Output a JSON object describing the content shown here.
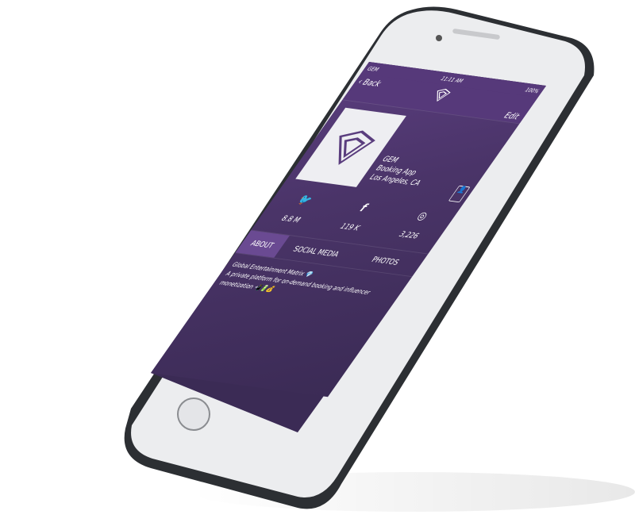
{
  "status_bar": {
    "carrier": "GEM",
    "time": "11:11 AM",
    "battery": "100%"
  },
  "nav": {
    "back_label": "Back",
    "edit_label": "Edit"
  },
  "profile": {
    "name": "GEM",
    "category": "Booking App",
    "location": "Los Angeles, CA"
  },
  "stats": [
    {
      "icon": "twitter-icon",
      "glyph": "🐦",
      "value": "8.8 M"
    },
    {
      "icon": "facebook-icon",
      "glyph": "f",
      "value": "119 K"
    },
    {
      "icon": "instagram-icon",
      "glyph": "◎",
      "value": "3,226"
    }
  ],
  "tabs": [
    {
      "label": "ABOUT",
      "active": true
    },
    {
      "label": "SOCIAL MEDIA"
    },
    {
      "label": "PHOTOS"
    }
  ],
  "bio": {
    "title": "Global Entertainment Matrix 💎",
    "text": "A private platform for on-demand booking and influencer monetization 📲🔋💰"
  },
  "colors": {
    "accent": "#56397a",
    "active_tab": "#6a4a92"
  }
}
